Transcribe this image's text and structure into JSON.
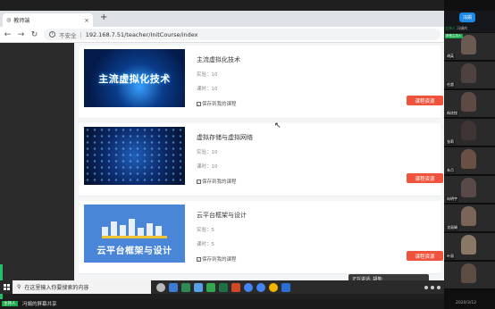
{
  "browser": {
    "tab_title": "教师端",
    "url_warning": "不安全",
    "url": "192.168.7.51/teacher/InitCourse/index"
  },
  "courses": [
    {
      "title": "主流虚拟化技术",
      "thumb_title": "主流虚拟化技术",
      "experiments": "实验：10",
      "hours": "课时：10",
      "save_label": "保存到我的课程",
      "button": "课程资源"
    },
    {
      "title": "虚拟存储与虚拟网络",
      "thumb_title": "",
      "experiments": "实验：10",
      "hours": "课时：10",
      "save_label": "保存到我的课程",
      "button": "课程资源"
    },
    {
      "title": "云平台框架与设计",
      "thumb_title": "云平台框架与设计",
      "experiments": "实验：5",
      "hours": "课时：5",
      "save_label": "保存到我的课程",
      "button": "课程资源"
    }
  ],
  "taskbar": {
    "search_placeholder": "在这里输入你要搜索的内容"
  },
  "meeting": {
    "speaking": "正在讲话: 胡英;",
    "share_host": "主持人",
    "share_text": "冯娟的屏幕共享",
    "badge": "冯娟",
    "host_label": "主持人",
    "host_name": "冯娟的",
    "time": "2020/3/12",
    "participants": [
      {
        "name": "胡英",
        "host": "其他主持人"
      },
      {
        "name": "任超"
      },
      {
        "name": "杨欣悦"
      },
      {
        "name": "张莉"
      },
      {
        "name": "朱月"
      },
      {
        "name": "向明宇"
      },
      {
        "name": "沈丽娟"
      },
      {
        "name": "叶丽"
      },
      {
        "name": ""
      }
    ]
  }
}
